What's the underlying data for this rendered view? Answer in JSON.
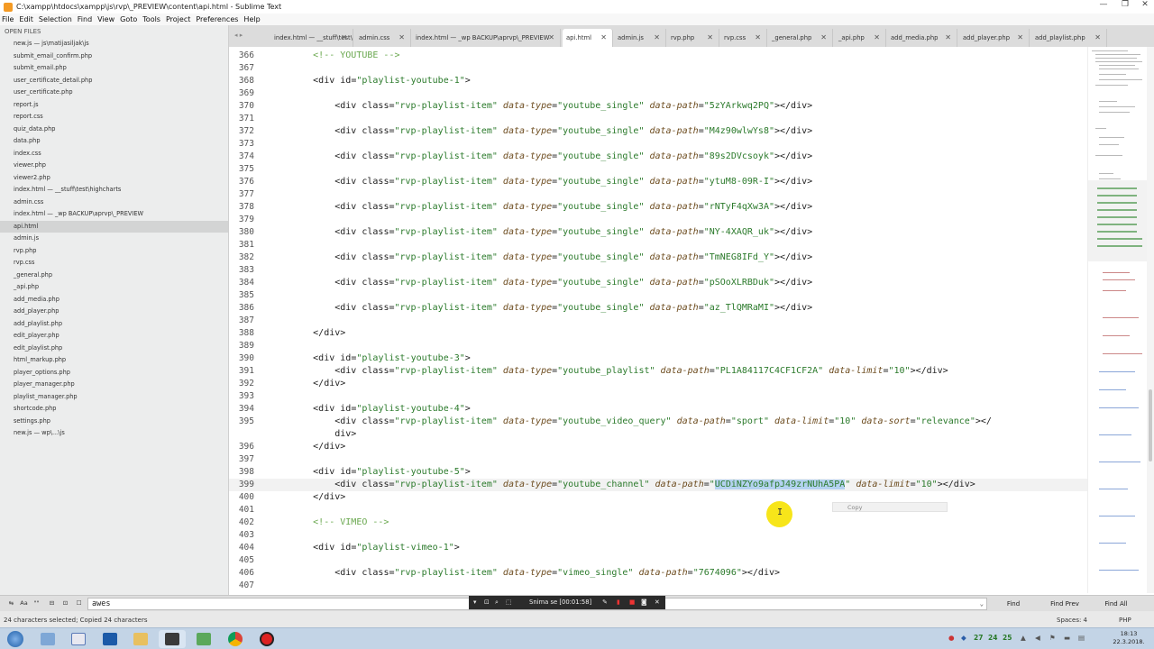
{
  "window": {
    "title": "C:\\xampp\\htdocs\\xampp\\js\\rvp\\_PREVIEW\\content\\api.html - Sublime Text",
    "minimize": "—",
    "maximize": "❐",
    "close": "✕"
  },
  "menu": [
    "File",
    "Edit",
    "Selection",
    "Find",
    "View",
    "Goto",
    "Tools",
    "Project",
    "Preferences",
    "Help"
  ],
  "sidebar": {
    "header": "OPEN FILES",
    "files": [
      "new.js — js\\matijasiljak\\js",
      "submit_email_confirm.php",
      "submit_email.php",
      "user_certificate_detail.php",
      "user_certificate.php",
      "report.js",
      "report.css",
      "quiz_data.php",
      "data.php",
      "index.css",
      "viewer.php",
      "viewer2.php",
      "index.html — __stuff\\test\\highcharts",
      "admin.css",
      "index.html — _wp BACKUP\\aprvp\\_PREVIEW",
      "api.html",
      "admin.js",
      "rvp.php",
      "rvp.css",
      "_general.php",
      "_api.php",
      "add_media.php",
      "add_player.php",
      "add_playlist.php",
      "edit_player.php",
      "edit_playlist.php",
      "html_markup.php",
      "player_options.php",
      "player_manager.php",
      "playlist_manager.php",
      "shortcode.php",
      "settings.php",
      "new.js — wp\\...\\js"
    ],
    "active_index": 15
  },
  "tabs": [
    {
      "label": "index.html — __stuff\\test\\"
    },
    {
      "label": "admin.css"
    },
    {
      "label": "index.html — _wp BACKUP\\aprvp\\_PREVIEW"
    },
    {
      "label": "api.html"
    },
    {
      "label": "admin.js"
    },
    {
      "label": "rvp.php"
    },
    {
      "label": "rvp.css"
    },
    {
      "label": "_general.php"
    },
    {
      "label": "_api.php"
    },
    {
      "label": "add_media.php"
    },
    {
      "label": "add_player.php"
    },
    {
      "label": "add_playlist.php"
    }
  ],
  "active_tab": 3,
  "tab_close": "✕",
  "tab_arrows": "◂ ▸",
  "editor": {
    "current_line": "399",
    "lines": [
      {
        "n": "366",
        "code": "        <!-- YOUTUBE -->"
      },
      {
        "n": "367",
        "code": ""
      },
      {
        "n": "368",
        "code": "        <div id=\"playlist-youtube-1\">"
      },
      {
        "n": "369",
        "code": ""
      },
      {
        "n": "370",
        "code": "            <div class=\"rvp-playlist-item\" data-type=\"youtube_single\" data-path=\"5zYArkwq2PQ\"></div>"
      },
      {
        "n": "371",
        "code": ""
      },
      {
        "n": "372",
        "code": "            <div class=\"rvp-playlist-item\" data-type=\"youtube_single\" data-path=\"M4z90wlwYs8\"></div>"
      },
      {
        "n": "373",
        "code": ""
      },
      {
        "n": "374",
        "code": "            <div class=\"rvp-playlist-item\" data-type=\"youtube_single\" data-path=\"89s2DVcsoyk\"></div>"
      },
      {
        "n": "375",
        "code": ""
      },
      {
        "n": "376",
        "code": "            <div class=\"rvp-playlist-item\" data-type=\"youtube_single\" data-path=\"ytuM8-09R-I\"></div>"
      },
      {
        "n": "377",
        "code": ""
      },
      {
        "n": "378",
        "code": "            <div class=\"rvp-playlist-item\" data-type=\"youtube_single\" data-path=\"rNTyF4qXw3A\"></div>"
      },
      {
        "n": "379",
        "code": ""
      },
      {
        "n": "380",
        "code": "            <div class=\"rvp-playlist-item\" data-type=\"youtube_single\" data-path=\"NY-4XAQR_uk\"></div>"
      },
      {
        "n": "381",
        "code": ""
      },
      {
        "n": "382",
        "code": "            <div class=\"rvp-playlist-item\" data-type=\"youtube_single\" data-path=\"TmNEG8IFd_Y\"></div>"
      },
      {
        "n": "383",
        "code": ""
      },
      {
        "n": "384",
        "code": "            <div class=\"rvp-playlist-item\" data-type=\"youtube_single\" data-path=\"pSOoXLRBDuk\"></div>"
      },
      {
        "n": "385",
        "code": ""
      },
      {
        "n": "386",
        "code": "            <div class=\"rvp-playlist-item\" data-type=\"youtube_single\" data-path=\"az_TlQMRaMI\"></div>"
      },
      {
        "n": "387",
        "code": ""
      },
      {
        "n": "388",
        "code": "        </div>"
      },
      {
        "n": "389",
        "code": ""
      },
      {
        "n": "390",
        "code": "        <div id=\"playlist-youtube-3\">"
      },
      {
        "n": "391",
        "code": "            <div class=\"rvp-playlist-item\" data-type=\"youtube_playlist\" data-path=\"PL1A84117C4CF1CF2A\" data-limit=\"10\"></div>"
      },
      {
        "n": "392",
        "code": "        </div>"
      },
      {
        "n": "393",
        "code": ""
      },
      {
        "n": "394",
        "code": "        <div id=\"playlist-youtube-4\">"
      },
      {
        "n": "395",
        "code": "            <div class=\"rvp-playlist-item\" data-type=\"youtube_video_query\" data-path=\"sport\" data-limit=\"10\" data-sort=\"relevance\"></"
      },
      {
        "n": "",
        "code": "            div>"
      },
      {
        "n": "396",
        "code": "        </div>"
      },
      {
        "n": "397",
        "code": ""
      },
      {
        "n": "398",
        "code": "        <div id=\"playlist-youtube-5\">"
      },
      {
        "n": "399",
        "code": "            <div class=\"rvp-playlist-item\" data-type=\"youtube_channel\" data-path=\"UCDiNZYo9afpJ49zrNUhA5PA\" data-limit=\"10\"></div>"
      },
      {
        "n": "400",
        "code": "        </div>"
      },
      {
        "n": "401",
        "code": ""
      },
      {
        "n": "402",
        "code": "        <!-- VIMEO -->"
      },
      {
        "n": "403",
        "code": ""
      },
      {
        "n": "404",
        "code": "        <div id=\"playlist-vimeo-1\">"
      },
      {
        "n": "405",
        "code": ""
      },
      {
        "n": "406",
        "code": "            <div class=\"rvp-playlist-item\" data-type=\"vimeo_single\" data-path=\"7674096\"></div>"
      },
      {
        "n": "407",
        "code": ""
      }
    ],
    "selection": "UCDiNZYo9afpJ49zrNUhA5PA",
    "copy_hint": "Copy",
    "cursor_glyph": "I"
  },
  "find": {
    "options": [
      "⇆",
      "Aa",
      "\"\"",
      "⊟",
      "⊡",
      "☐"
    ],
    "value": "awes",
    "dropdown": "⌄",
    "find_label": "Find",
    "find_prev_label": "Find Prev",
    "find_all_label": "Find All"
  },
  "recorder": {
    "label": "Snima se [00:01:58]"
  },
  "status": {
    "message": "24 characters selected; Copied 24 characters",
    "spaces": "Spaces: 4",
    "syntax": "PHP"
  },
  "taskbar": {
    "apps": [
      "start-orb",
      "explorer-window",
      "notepad",
      "visual-studio",
      "file-explorer",
      "sublime-text",
      "calculator",
      "chrome",
      "recorder"
    ],
    "tray": [
      "27",
      "24",
      "25"
    ],
    "time": "18:13",
    "date": "22.3.2018."
  },
  "colors": {
    "tag": "#222222",
    "attribute": "#6d4c1f",
    "string": "#2b7a2b",
    "comment": "#6aa84f",
    "selection": "#b4d2f0",
    "cursor_highlight": "#f7e51a"
  }
}
